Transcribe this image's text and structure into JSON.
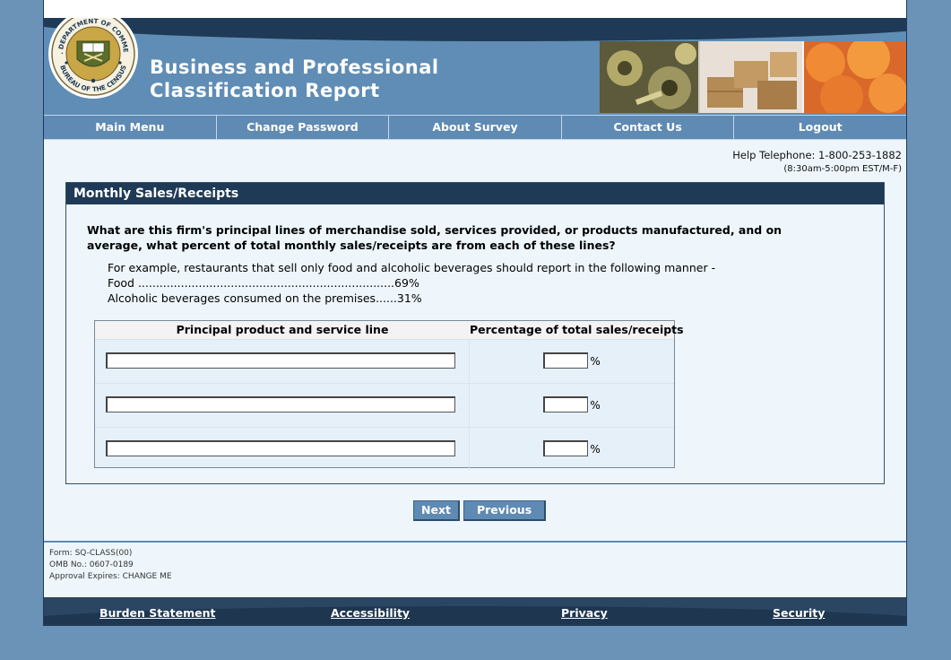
{
  "header": {
    "title_line1": "Business and Professional",
    "title_line2": "Classification Report",
    "seal_top_text": "U.S. DEPARTMENT OF COMMERCE",
    "seal_bottom_text": "BUREAU OF THE CENSUS"
  },
  "nav": {
    "items": [
      {
        "label": "Main Menu"
      },
      {
        "label": "Change Password"
      },
      {
        "label": "About Survey"
      },
      {
        "label": "Contact Us"
      },
      {
        "label": "Logout"
      }
    ]
  },
  "help": {
    "telephone": "Help Telephone: 1-800-253-1882",
    "hours": "(8:30am-5:00pm EST/M-F)"
  },
  "section": {
    "title": "Monthly Sales/Receipts",
    "question": "What are this firm's principal lines of merchandise sold, services provided, or products manufactured, and on average, what percent of total monthly sales/receipts are from each of these lines?",
    "example_intro": "For example, restaurants that sell only food and alcoholic beverages should report in the following manner -",
    "example_food": "Food ........................................................................69%",
    "example_alcohol": "Alcoholic beverages consumed on the premises......31%"
  },
  "table": {
    "col1_header": "Principal product and service line",
    "col2_header": "Percentage of total sales/receipts",
    "percent_sign": "%",
    "rows": [
      {
        "line_value": "",
        "percent_value": ""
      },
      {
        "line_value": "",
        "percent_value": ""
      },
      {
        "line_value": "",
        "percent_value": ""
      }
    ]
  },
  "buttons": {
    "next": "Next",
    "previous": "Previous"
  },
  "form_info": {
    "form": "Form: SQ-CLASS(00)",
    "omb": "OMB No.: 0607-0189",
    "approval": "Approval Expires: CHANGE ME"
  },
  "footer": {
    "links": [
      {
        "label": "Burden Statement"
      },
      {
        "label": "Accessibility"
      },
      {
        "label": "Privacy"
      },
      {
        "label": "Security"
      }
    ]
  },
  "colors": {
    "page_bg": "#6b93b7",
    "dark_navy": "#1f3a56",
    "nav_blue": "#5e8ab3",
    "content_bg": "#eef6fc"
  }
}
